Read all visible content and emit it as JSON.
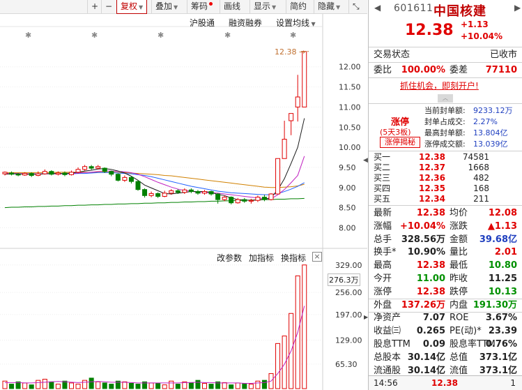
{
  "toolbar": {
    "plus": "+",
    "minus": "−",
    "adjust": "复权",
    "overlay": "叠加",
    "chips": "筹码",
    "draw": "画线",
    "display": "显示",
    "simple": "简约",
    "hide": "隐藏",
    "nav_left": "◀",
    "nav_right": "▶"
  },
  "chart": {
    "subbar": {
      "hgt": "沪股通",
      "margin": "融资融券",
      "ma_settings": "设置均线"
    },
    "price_axis": [
      "12.00",
      "11.50",
      "11.00",
      "10.50",
      "10.00",
      "9.50",
      "9.00",
      "8.50",
      "8.00"
    ],
    "last_price_tag": "12.38",
    "indicator_toolbar": {
      "params": "改参数",
      "add": "加指标",
      "switch": "换指标",
      "close": "×"
    },
    "volume_axis": [
      "329.00",
      "256.00",
      "197.00",
      "129.00",
      "65.30"
    ],
    "volume_readout": "276.3万",
    "collapse_tab": "▶",
    "side_arrow": "◀",
    "colors": {
      "up": "#e00000",
      "down": "#008000",
      "ma5": "#1a1a1a",
      "ma10": "#c020c0",
      "ma20": "#2060ff",
      "ma60": "#d08000",
      "ma120": "#008000"
    }
  },
  "chart_data": {
    "type": "candlestick",
    "ylim": [
      7.8,
      12.55
    ],
    "candles": [
      {
        "o": 9.34,
        "c": 9.38,
        "h": 9.4,
        "l": 9.3
      },
      {
        "o": 9.36,
        "c": 9.33,
        "h": 9.4,
        "l": 9.3
      },
      {
        "o": 9.33,
        "c": 9.31,
        "h": 9.36,
        "l": 9.28
      },
      {
        "o": 9.31,
        "c": 9.35,
        "h": 9.38,
        "l": 9.29
      },
      {
        "o": 9.35,
        "c": 9.3,
        "h": 9.38,
        "l": 9.26
      },
      {
        "o": 9.3,
        "c": 9.34,
        "h": 9.4,
        "l": 9.28
      },
      {
        "o": 9.34,
        "c": 9.4,
        "h": 9.45,
        "l": 9.32
      },
      {
        "o": 9.4,
        "c": 9.33,
        "h": 9.43,
        "l": 9.3
      },
      {
        "o": 9.33,
        "c": 9.36,
        "h": 9.4,
        "l": 9.3
      },
      {
        "o": 9.36,
        "c": 9.32,
        "h": 9.4,
        "l": 9.28
      },
      {
        "o": 9.32,
        "c": 9.38,
        "h": 9.42,
        "l": 9.3
      },
      {
        "o": 9.38,
        "c": 9.45,
        "h": 9.5,
        "l": 9.35
      },
      {
        "o": 9.45,
        "c": 9.52,
        "h": 9.56,
        "l": 9.42
      },
      {
        "o": 9.52,
        "c": 9.48,
        "h": 9.56,
        "l": 9.44
      },
      {
        "o": 9.48,
        "c": 9.52,
        "h": 9.56,
        "l": 9.45
      },
      {
        "o": 9.48,
        "c": 9.4,
        "h": 9.5,
        "l": 9.36
      },
      {
        "o": 9.4,
        "c": 9.33,
        "h": 9.42,
        "l": 9.28
      },
      {
        "o": 9.33,
        "c": 9.18,
        "h": 9.35,
        "l": 9.15
      },
      {
        "o": 9.18,
        "c": 9.25,
        "h": 9.3,
        "l": 9.14
      },
      {
        "o": 9.25,
        "c": 9.15,
        "h": 9.28,
        "l": 9.1
      },
      {
        "o": 9.15,
        "c": 8.95,
        "h": 9.18,
        "l": 8.92
      },
      {
        "o": 8.95,
        "c": 8.8,
        "h": 8.98,
        "l": 8.75
      },
      {
        "o": 8.8,
        "c": 8.85,
        "h": 8.9,
        "l": 8.76
      },
      {
        "o": 8.85,
        "c": 8.78,
        "h": 8.88,
        "l": 8.74
      },
      {
        "o": 8.78,
        "c": 8.86,
        "h": 8.92,
        "l": 8.76
      },
      {
        "o": 8.86,
        "c": 8.92,
        "h": 8.96,
        "l": 8.82
      },
      {
        "o": 8.92,
        "c": 8.88,
        "h": 8.96,
        "l": 8.84
      },
      {
        "o": 8.88,
        "c": 8.94,
        "h": 8.98,
        "l": 8.84
      },
      {
        "o": 8.94,
        "c": 8.9,
        "h": 8.98,
        "l": 8.86
      },
      {
        "o": 8.9,
        "c": 8.86,
        "h": 8.94,
        "l": 8.82
      },
      {
        "o": 8.86,
        "c": 8.9,
        "h": 8.94,
        "l": 8.82
      },
      {
        "o": 8.9,
        "c": 8.84,
        "h": 8.92,
        "l": 8.8
      },
      {
        "o": 8.84,
        "c": 8.7,
        "h": 8.86,
        "l": 8.6
      },
      {
        "o": 8.7,
        "c": 8.76,
        "h": 8.8,
        "l": 8.66
      },
      {
        "o": 8.76,
        "c": 8.62,
        "h": 8.78,
        "l": 8.58
      },
      {
        "o": 8.62,
        "c": 8.7,
        "h": 8.74,
        "l": 8.6
      },
      {
        "o": 8.7,
        "c": 8.66,
        "h": 8.74,
        "l": 8.62
      },
      {
        "o": 8.66,
        "c": 8.68,
        "h": 8.72,
        "l": 8.6
      },
      {
        "o": 8.68,
        "c": 8.76,
        "h": 8.8,
        "l": 8.64
      },
      {
        "o": 8.76,
        "c": 8.7,
        "h": 8.82,
        "l": 8.66
      },
      {
        "o": 8.7,
        "c": 8.84,
        "h": 8.86,
        "l": 8.68
      },
      {
        "o": 8.84,
        "c": 9.72,
        "h": 9.72,
        "l": 8.84
      },
      {
        "o": 9.72,
        "c": 10.2,
        "h": 10.66,
        "l": 9.72
      },
      {
        "o": 10.66,
        "c": 10.84,
        "h": 10.84,
        "l": 10.3
      },
      {
        "o": 11.0,
        "c": 11.25,
        "h": 11.8,
        "l": 10.64
      },
      {
        "o": 11.0,
        "c": 12.38,
        "h": 12.38,
        "l": 11.0
      }
    ],
    "ma5": [
      9.33,
      9.34,
      9.34,
      9.33,
      9.33,
      9.33,
      9.34,
      9.35,
      9.35,
      9.35,
      9.36,
      9.38,
      9.41,
      9.43,
      9.46,
      9.47,
      9.45,
      9.41,
      9.36,
      9.28,
      9.18,
      9.06,
      8.99,
      8.92,
      8.85,
      8.84,
      8.86,
      8.88,
      8.9,
      8.9,
      8.9,
      8.88,
      8.83,
      8.8,
      8.74,
      8.7,
      8.69,
      8.68,
      8.69,
      8.71,
      8.75,
      8.94,
      9.22,
      9.6,
      10.0,
      10.72
    ],
    "ma10": [
      9.35,
      9.35,
      9.35,
      9.34,
      9.34,
      9.34,
      9.34,
      9.34,
      9.34,
      9.34,
      9.35,
      9.36,
      9.37,
      9.38,
      9.4,
      9.41,
      9.41,
      9.4,
      9.39,
      9.37,
      9.33,
      9.27,
      9.2,
      9.13,
      9.07,
      9.01,
      8.96,
      8.93,
      8.91,
      8.88,
      8.87,
      8.87,
      8.86,
      8.84,
      8.82,
      8.8,
      8.78,
      8.76,
      8.74,
      8.72,
      8.72,
      8.82,
      8.95,
      9.12,
      9.3,
      9.78
    ],
    "ma20": [
      9.34,
      9.34,
      9.34,
      9.34,
      9.34,
      9.34,
      9.34,
      9.34,
      9.34,
      9.34,
      9.34,
      9.35,
      9.35,
      9.36,
      9.37,
      9.37,
      9.37,
      9.36,
      9.35,
      9.34,
      9.32,
      9.3,
      9.27,
      9.23,
      9.19,
      9.15,
      9.11,
      9.07,
      9.03,
      9.0,
      8.97,
      8.94,
      8.91,
      8.89,
      8.87,
      8.86,
      8.85,
      8.84,
      8.83,
      8.82,
      8.82,
      8.85,
      8.9,
      8.96,
      9.03,
      9.12
    ],
    "ma60": [
      9.37,
      9.37,
      9.37,
      9.37,
      9.37,
      9.37,
      9.37,
      9.37,
      9.38,
      9.38,
      9.38,
      9.38,
      9.38,
      9.38,
      9.38,
      9.38,
      9.38,
      9.37,
      9.37,
      9.36,
      9.35,
      9.34,
      9.33,
      9.32,
      9.3,
      9.29,
      9.27,
      9.25,
      9.23,
      9.21,
      9.19,
      9.17,
      9.15,
      9.13,
      9.11,
      9.09,
      9.07,
      9.05,
      9.03,
      9.01,
      9.0,
      9.0,
      9.01,
      9.02,
      9.04,
      9.08
    ],
    "ma120": [
      8.5,
      8.51,
      8.51,
      8.52,
      8.52,
      8.53,
      8.53,
      8.54,
      8.54,
      8.55,
      8.55,
      8.56,
      8.56,
      8.57,
      8.57,
      8.58,
      8.58,
      8.59,
      8.59,
      8.6,
      8.6,
      8.61,
      8.61,
      8.62,
      8.62,
      8.63,
      8.63,
      8.64,
      8.64,
      8.65,
      8.65,
      8.66,
      8.66,
      8.67,
      8.67,
      8.68,
      8.68,
      8.69,
      8.69,
      8.7,
      8.7,
      8.71,
      8.71,
      8.72,
      8.72,
      8.73
    ],
    "volume_ylim": [
      0,
      336
    ],
    "volume": [
      20,
      12,
      18,
      15,
      10,
      22,
      25,
      18,
      12,
      20,
      15,
      12,
      22,
      28,
      18,
      15,
      12,
      20,
      18,
      14,
      12,
      18,
      15,
      14,
      10,
      20,
      12,
      18,
      16,
      22,
      14,
      12,
      18,
      16,
      10,
      15,
      14,
      12,
      20,
      22,
      40,
      120,
      140,
      200,
      300,
      329
    ],
    "vol_ma": [
      16,
      16,
      16,
      15,
      15,
      16,
      17,
      18,
      19,
      18,
      17,
      16,
      17,
      18,
      19,
      18,
      17,
      17,
      17,
      16,
      15,
      15,
      15,
      15,
      15,
      15,
      15,
      16,
      16,
      17,
      16,
      16,
      15,
      15,
      15,
      15,
      14,
      14,
      15,
      16,
      20,
      40,
      65,
      100,
      150,
      220
    ]
  },
  "quote": {
    "nav_left": "◀",
    "nav_right": "▶",
    "code": "601611",
    "name": "中国核建",
    "price": "12.38",
    "change": "+1.13",
    "change_pct": "+10.04%",
    "trade_status_label": "交易状态",
    "trade_status": "已收市",
    "bid_ratio_label": "委比",
    "bid_ratio": "100.00%",
    "bid_diff_label": "委差",
    "bid_diff": "77110",
    "promo": "抓住机会，即刻开户!",
    "promo_arrow": "︿",
    "limit_up": {
      "title": "涨停",
      "board": "(5天3板)",
      "reveal": "涨停揭秘",
      "rows": [
        {
          "k": "当前封单额:",
          "v": "9233.12万"
        },
        {
          "k": "封单占成交:",
          "v": "2.27%"
        },
        {
          "k": "最高封单额:",
          "v": "13.804亿"
        },
        {
          "k": "涨停成交额:",
          "v": "13.039亿"
        }
      ]
    },
    "order_book": [
      {
        "k": "买一",
        "p": "12.38",
        "q": "74581"
      },
      {
        "k": "买二",
        "p": "12.37",
        "q": "1668"
      },
      {
        "k": "买三",
        "p": "12.36",
        "q": "482"
      },
      {
        "k": "买四",
        "p": "12.35",
        "q": "168"
      },
      {
        "k": "买五",
        "p": "12.34",
        "q": "211"
      }
    ],
    "stats": [
      {
        "k1": "最新",
        "v1": "12.38",
        "c1": "red",
        "k2": "均价",
        "v2": "12.08",
        "c2": "red"
      },
      {
        "k1": "涨幅",
        "v1": "+10.04%",
        "c1": "red",
        "k2": "涨跌",
        "v2": "▲1.13",
        "c2": "red"
      },
      {
        "k1": "总手",
        "v1": "328.56万",
        "c1": "dark",
        "k2": "金额",
        "v2": "39.68亿",
        "c2": "blue"
      },
      {
        "k1": "换手*",
        "v1": "10.90%",
        "c1": "dark",
        "k2": "量比",
        "v2": "2.01",
        "c2": "red"
      },
      {
        "k1": "最高",
        "v1": "12.38",
        "c1": "red",
        "k2": "最低",
        "v2": "10.80",
        "c2": "green"
      },
      {
        "k1": "今开",
        "v1": "11.00",
        "c1": "green",
        "k2": "昨收",
        "v2": "11.25",
        "c2": "dark"
      },
      {
        "k1": "涨停",
        "v1": "12.38",
        "c1": "red",
        "k2": "跌停",
        "v2": "10.13",
        "c2": "green"
      },
      {
        "k1": "外盘",
        "v1": "137.26万",
        "c1": "red",
        "k2": "内盘",
        "v2": "191.30万",
        "c2": "green"
      },
      {
        "k1": "净资产",
        "v1": "7.07",
        "c1": "dark",
        "k2": "ROE",
        "v2": "3.67%",
        "c2": "dark"
      },
      {
        "k1": "收益㈢",
        "v1": "0.265",
        "c1": "dark",
        "k2": "PE(动)*",
        "v2": "23.39",
        "c2": "dark"
      },
      {
        "k1": "股息TTM",
        "v1": "0.09",
        "c1": "dark",
        "k2": "股息率TTM",
        "v2": "0.76%",
        "c2": "dark"
      },
      {
        "k1": "总股本",
        "v1": "30.14亿",
        "c1": "dark",
        "k2": "总值",
        "v2": "373.1亿",
        "c2": "dark"
      },
      {
        "k1": "流通股",
        "v1": "30.14亿",
        "c1": "dark",
        "k2": "流值",
        "v2": "373.1亿",
        "c2": "dark"
      }
    ],
    "tick": {
      "time": "14:56",
      "price": "12.38",
      "vol": "1"
    }
  }
}
